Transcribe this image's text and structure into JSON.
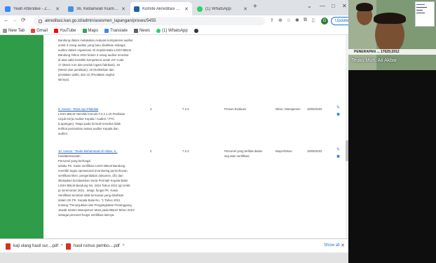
{
  "tabs": [
    {
      "label": "Yeah Attendee - Zoom",
      "active": false,
      "color": "#2d8cff"
    },
    {
      "label": "36. Kebanwan Kiam - Flask - BSN",
      "active": false,
      "color": "#4a90d9"
    },
    {
      "label": "Komite Akreditasi Nasional - NKS",
      "active": true,
      "color": "#1f5fa8"
    },
    {
      "label": "(1) WhatsApp",
      "active": false,
      "color": "#25d366"
    }
  ],
  "address": {
    "url": "akreditasi.kan.go.id/admin/asesmen_lapangan/proses/5455"
  },
  "toolbar": {
    "avatar_letter": "G",
    "update_label": "Update"
  },
  "bookmarks": [
    "New Tab",
    "Gmail",
    "YouTube",
    "Maps",
    "Translate",
    "News",
    "(1) WhatsApp"
  ],
  "page": {
    "top_block": [
      "Bandung dalam melakukan evaluasi kompetensi auditor",
      "untuk 3 orang auditor yang baru disahkan sebagai",
      "auditor dalam organisasi. Di Kepala Balai LSSH BBLM",
      "Bandung Tahun 2022 belum 3 orang auditor tersebut",
      "di atas valid memiliki kompetensi untuk IAF Code",
      "17 (Basic Iron dan produk logam fabrikasi), 18",
      "(Mesin dan peralatan), 19 (Kelistrikan dan",
      "peralatan optik), dan 22 (Peralatan angkut",
      "lainnya)."
    ],
    "row9": {
      "header": "9. Asesor : Rima Ayu Pitalokai",
      "lines": [
        "LSSH BBLM memiliki formulir F.2.2.1.10 Penilaian",
        "Unjuk Kerja Auditor Kepala / Auditor / PTC",
        "(Lapangan). Tetapi pada formulir tersebut tidak",
        "terlihat pemisahan antara auditor Kepala dan",
        "auditor."
      ],
      "col1": "2",
      "col2": "7.2.3",
      "col3": "Proses Evaluasi",
      "col4": "Minor; Manajemen",
      "col5": "18/05/2022"
    },
    "row10": {
      "header": "10. Asesor : Teuku Muhammad Ali Akbar, S.,",
      "lines": [
        "Ketidaksesuaian :",
        " ",
        "Personel yang berfungsi",
        "selaku PK. Kasie sertifikasi LSSH BBLM Bandung",
        "memiliki tugas operasional (monitoring permohonan",
        "sertifikasi klien, pengendalian dokumen, dll.) dan",
        "ditetapkan berdasarkan Surat Perintah Kepala Balai",
        "LSSH BBLM Bandung No. 2464 Tahun 2021 tgl 1m60",
        "pt seremonter 2021 . tetapi, fungsi PK. Kasie",
        "Sertifikasi tersebut tidak termasuk yang disahkan",
        "dalam SK PK. Kepala Balai No. \"1 Tahun 2021",
        "tentang \"Penunjukkan dan Pengangkatan Penanggung",
        "Jawab Sistem Manajemen Mutu pada BBLM Tahun 2021\"",
        "sebagai personel fungsi sertifikasi lainnya."
      ],
      "col1": "2",
      "col2": "7.2.3",
      "col3": "Personel yang terlibat dalam seg atan sertifikasi",
      "col4": "Mayor/Minor",
      "col5": "18/05/2022"
    }
  },
  "downloads": [
    {
      "label": "kaji ulang hasil sur....pdf"
    },
    {
      "label": "hasil rumus pembo....pdf"
    }
  ],
  "shelf": {
    "show_all": "Show all"
  },
  "video": {
    "banner": "PENERAPAN ... 17025:2012",
    "name": "Teuku Muh. Ali Akbar"
  }
}
